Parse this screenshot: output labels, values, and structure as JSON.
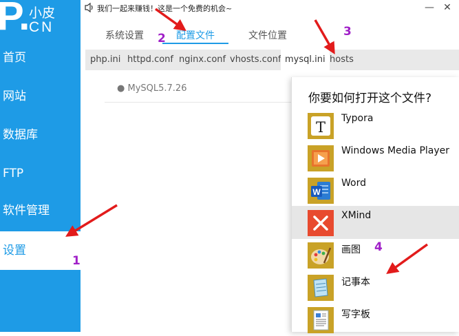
{
  "sidebar": {
    "logo": {
      "big": "P.",
      "line1": "小皮",
      "line2": "CN"
    },
    "items": [
      {
        "label": "首页"
      },
      {
        "label": "网站"
      },
      {
        "label": "数据库"
      },
      {
        "label": "FTP"
      },
      {
        "label": "软件管理"
      },
      {
        "label": "设置"
      }
    ],
    "active_index": 5
  },
  "titlebar": {
    "message": "我们一起来赚钱！这是一个免费的机会~",
    "minimize": "—",
    "close": "✕",
    "speaker_icon": "speaker-icon"
  },
  "tabs": [
    {
      "label": "系统设置"
    },
    {
      "label": "配置文件"
    },
    {
      "label": "文件位置"
    }
  ],
  "subtabs": [
    {
      "label": "php.ini"
    },
    {
      "label": "httpd.conf"
    },
    {
      "label": "nginx.conf"
    },
    {
      "label": "vhosts.conf"
    },
    {
      "label": "mysql.ini"
    },
    {
      "label": "hosts"
    }
  ],
  "content": {
    "item": "● MySQL5.7.26"
  },
  "dialog": {
    "title": "你要如何打开这个文件?",
    "apps": [
      {
        "name": "Typora",
        "icon": "typora-icon"
      },
      {
        "name": "Windows Media Player",
        "icon": "media-player-icon"
      },
      {
        "name": "Word",
        "icon": "word-icon"
      },
      {
        "name": "XMind",
        "icon": "xmind-icon"
      },
      {
        "name": "画图",
        "icon": "paint-icon"
      },
      {
        "name": "记事本",
        "icon": "notepad-icon"
      },
      {
        "name": "写字板",
        "icon": "wordpad-icon"
      }
    ]
  },
  "annotations": {
    "n1": "1",
    "n2": "2",
    "n3": "3",
    "n4": "4"
  },
  "colors": {
    "accent": "#1e9be6",
    "arrow": "#e21b1b",
    "number": "#a020c8"
  }
}
